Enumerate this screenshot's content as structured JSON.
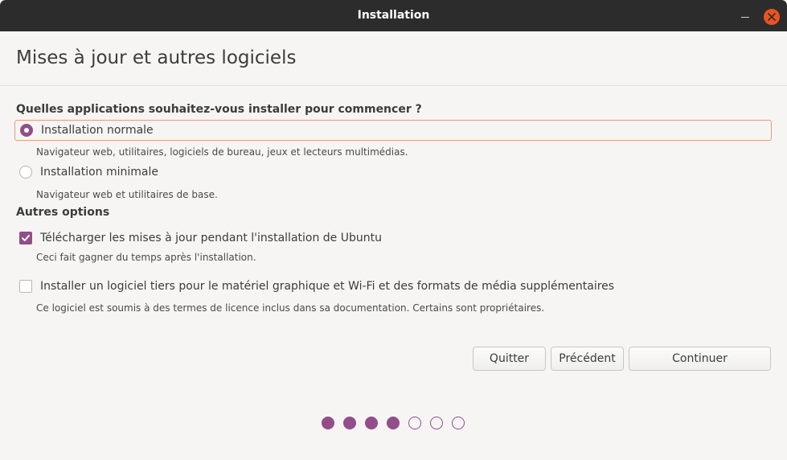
{
  "window": {
    "title": "Installation"
  },
  "page": {
    "heading": "Mises à jour et autres logiciels"
  },
  "apps_question": "Quelles applications souhaitez-vous installer pour commencer ?",
  "install_options": [
    {
      "label": "Installation normale",
      "description": "Navigateur web, utilitaires, logiciels de bureau, jeux et lecteurs multimédias.",
      "selected": true
    },
    {
      "label": "Installation minimale",
      "description": "Navigateur web et utilitaires de base.",
      "selected": false
    }
  ],
  "other_options": {
    "heading": "Autres options",
    "items": [
      {
        "label": "Télécharger les mises à jour pendant l'installation de Ubuntu",
        "description": "Ceci fait gagner du temps après l'installation.",
        "checked": true
      },
      {
        "label": "Installer un logiciel tiers pour le matériel graphique et Wi-Fi et des formats de média supplémentaires",
        "description": "Ce logiciel est soumis à des termes de licence inclus dans sa documentation. Certains sont propriétaires.",
        "checked": false
      }
    ]
  },
  "buttons": {
    "quit": "Quitter",
    "previous": "Précédent",
    "continue": "Continuer"
  },
  "progress": {
    "total_steps": 7,
    "completed_steps": 4
  },
  "colors": {
    "accent": "#924d8b",
    "close_button": "#e95420",
    "focus_border": "#e99b7b",
    "titlebar": "#2c2c2c"
  },
  "icons": [
    "close-icon",
    "minimize-icon",
    "checkmark-icon"
  ]
}
